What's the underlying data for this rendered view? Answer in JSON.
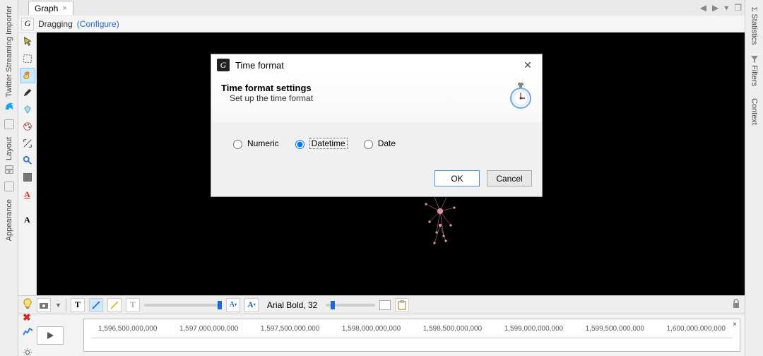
{
  "tabs": {
    "graph": "Graph"
  },
  "mode": {
    "label": "Dragging",
    "configure": "(Configure)"
  },
  "left_panels": {
    "twitter": "Twitter Streaming Importer",
    "layout": "Layout",
    "appearance": "Appearance"
  },
  "right_panels": {
    "statistics": "Statistics",
    "filters": "Filters",
    "context": "Context"
  },
  "toolbox": {
    "arrow": "arrow",
    "marquee": "marquee",
    "hand": "hand",
    "pen": "pen",
    "diamond": "diamond",
    "palette": "palette",
    "size": "size",
    "zoom": "zoom",
    "square": "square",
    "text_color": "A",
    "text_default": "A"
  },
  "bottom_toolbar": {
    "font_label": "Arial Bold, 32",
    "a_minus": "A",
    "a_plus": "A"
  },
  "timeline": {
    "ticks": [
      "1,596,500,000,000",
      "1,597,000,000,000",
      "1,597,500,000,000",
      "1,598,000,000,000",
      "1,598,500,000,000",
      "1,599,000,000,000",
      "1,599,500,000,000",
      "1,600,000,000,000"
    ]
  },
  "dialog": {
    "title": "Time format",
    "heading": "Time format settings",
    "subheading": "Set up the time format",
    "opt_numeric": "Numeric",
    "opt_datetime": "Datetime",
    "opt_date": "Date",
    "ok": "OK",
    "cancel": "Cancel"
  }
}
